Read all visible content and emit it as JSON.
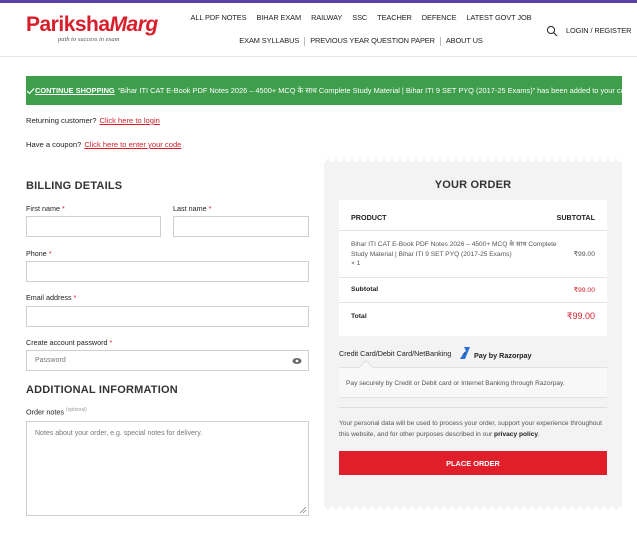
{
  "brand": {
    "logo_part1": "Pariksha",
    "logo_part2": "Marg",
    "tagline": "path to success in exam"
  },
  "nav": {
    "row1": [
      "ALL PDF NOTES",
      "BIHAR EXAM",
      "RAILWAY",
      "SSC",
      "TEACHER",
      "DEFENCE",
      "LATEST GOVT JOB"
    ],
    "row2": [
      "EXAM SYLLABUS",
      "PREVIOUS YEAR QUESTION PAPER",
      "ABOUT US"
    ],
    "login": "LOGIN / REGISTER"
  },
  "notice": {
    "link": "CONTINUE SHOPPING",
    "message": "“Bihar ITI CAT E-Book PDF Notes 2026 – 4500+ MCQ के साथ Complete Study Material | Bihar ITI 9 SET PYQ (2017-25 Exams)” has been added to your cart."
  },
  "returning": {
    "text": "Returning customer?",
    "link": "Click here to login"
  },
  "coupon": {
    "text": "Have a coupon?",
    "link": "Click here to enter your code"
  },
  "billing": {
    "title": "BILLING DETAILS",
    "first_name": "First name",
    "last_name": "Last name",
    "phone": "Phone",
    "email": "Email address",
    "password": "Create account password",
    "password_placeholder": "Password",
    "required_mark": "*"
  },
  "additional": {
    "title": "ADDITIONAL INFORMATION",
    "order_notes": "Order notes",
    "optional": "(optional)",
    "notes_placeholder": "Notes about your order, e.g. special notes for delivery."
  },
  "order": {
    "title": "YOUR ORDER",
    "col_product": "PRODUCT",
    "col_subtotal": "SUBTOTAL",
    "product_name": "Bihar ITI CAT E-Book PDF Notes 2026 – 4500+ MCQ के साथ Complete Study Material | Bihar ITI 9 SET PYQ (2017-25 Exams)",
    "quantity": "× 1",
    "product_price": "₹99.00",
    "subtotal_label": "Subtotal",
    "subtotal_value": "₹99.00",
    "total_label": "Total",
    "total_value": "₹99.00"
  },
  "payment": {
    "method": "Credit Card/Debit Card/NetBanking",
    "provider": "Pay by Razorpay",
    "description": "Pay securely by Credit or Debit card or Internet Banking through Razorpay.",
    "privacy_text": "Your personal data will be used to process your order, support your experience throughout this website, and for other purposes described in our ",
    "privacy_link": "privacy policy",
    "privacy_end": ".",
    "place_order": "PLACE ORDER"
  },
  "colors": {
    "brand_red": "#d81e2a",
    "notice_green": "#3f9e4b",
    "button_red": "#e01f2b",
    "top_bar": "#5b3fa6"
  }
}
